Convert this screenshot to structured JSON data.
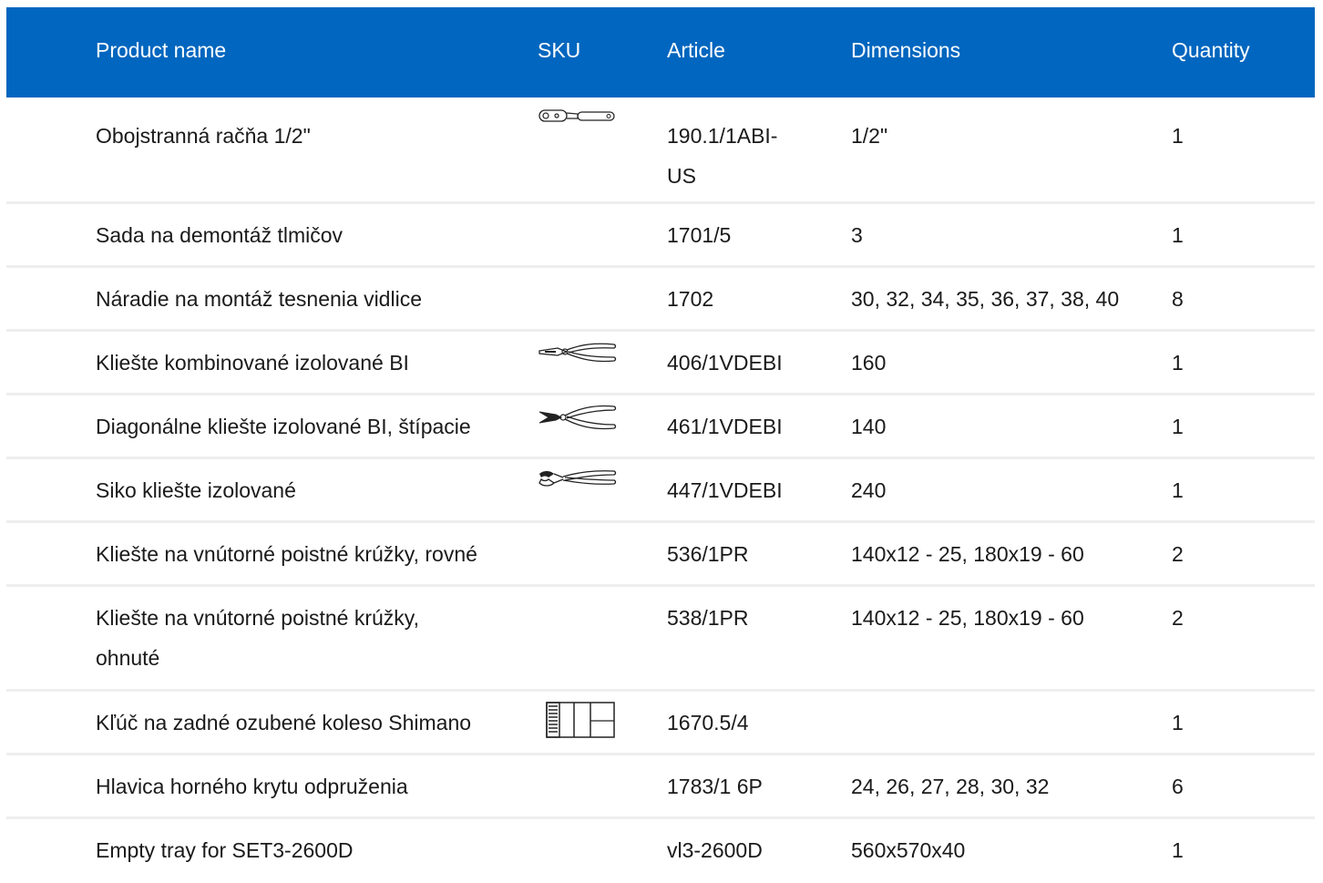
{
  "header": {
    "product_name": "Product name",
    "sku": "SKU",
    "article": "Article",
    "dimensions": "Dimensions",
    "quantity": "Quantity"
  },
  "rows": [
    {
      "name": "Obojstranná račňa 1/2\"",
      "sku_icon": "ratchet-icon",
      "article": "190.1/1ABI-US",
      "dimensions": "1/2\"",
      "quantity": "1"
    },
    {
      "name": "Sada na demontáž tlmičov",
      "sku_icon": "",
      "article": "1701/5",
      "dimensions": "3",
      "quantity": "1"
    },
    {
      "name": "Náradie na montáž tesnenia vidlice",
      "sku_icon": "",
      "article": "1702",
      "dimensions": "30, 32, 34, 35, 36, 37, 38, 40",
      "quantity": "8"
    },
    {
      "name": "Kliešte kombinované izolované BI",
      "sku_icon": "combination-pliers-icon",
      "article": "406/1VDEBI",
      "dimensions": "160",
      "quantity": "1"
    },
    {
      "name": "Diagonálne kliešte izolované BI, štípacie",
      "sku_icon": "diagonal-cutters-icon",
      "article": "461/1VDEBI",
      "dimensions": "140",
      "quantity": "1"
    },
    {
      "name": "Siko kliešte izolované",
      "sku_icon": "water-pump-pliers-icon",
      "article": "447/1VDEBI",
      "dimensions": "240",
      "quantity": "1"
    },
    {
      "name": "Kliešte na vnútorné poistné krúžky, rovné",
      "sku_icon": "",
      "article": "536/1PR",
      "dimensions": "140x12 - 25, 180x19 - 60",
      "quantity": "2"
    },
    {
      "name": "Kliešte na vnútorné poistné krúžky, ohnuté",
      "sku_icon": "",
      "article": "538/1PR",
      "dimensions": "140x12 - 25, 180x19 - 60",
      "quantity": "2"
    },
    {
      "name": "Kľúč na zadné ozubené koleso Shimano",
      "sku_icon": "cassette-tool-icon",
      "article": "1670.5/4",
      "dimensions": "",
      "quantity": "1"
    },
    {
      "name": "Hlavica horného krytu odpruženia",
      "sku_icon": "",
      "article": "1783/1 6P",
      "dimensions": "24, 26, 27, 28, 30, 32",
      "quantity": "6"
    },
    {
      "name": "Empty tray for SET3-2600D",
      "sku_icon": "",
      "article": "vl3-2600D",
      "dimensions": "560x570x40",
      "quantity": "1"
    }
  ],
  "colors": {
    "header_bg": "#0066bf",
    "header_text": "#ffffff",
    "row_divider": "#eeeeee"
  }
}
